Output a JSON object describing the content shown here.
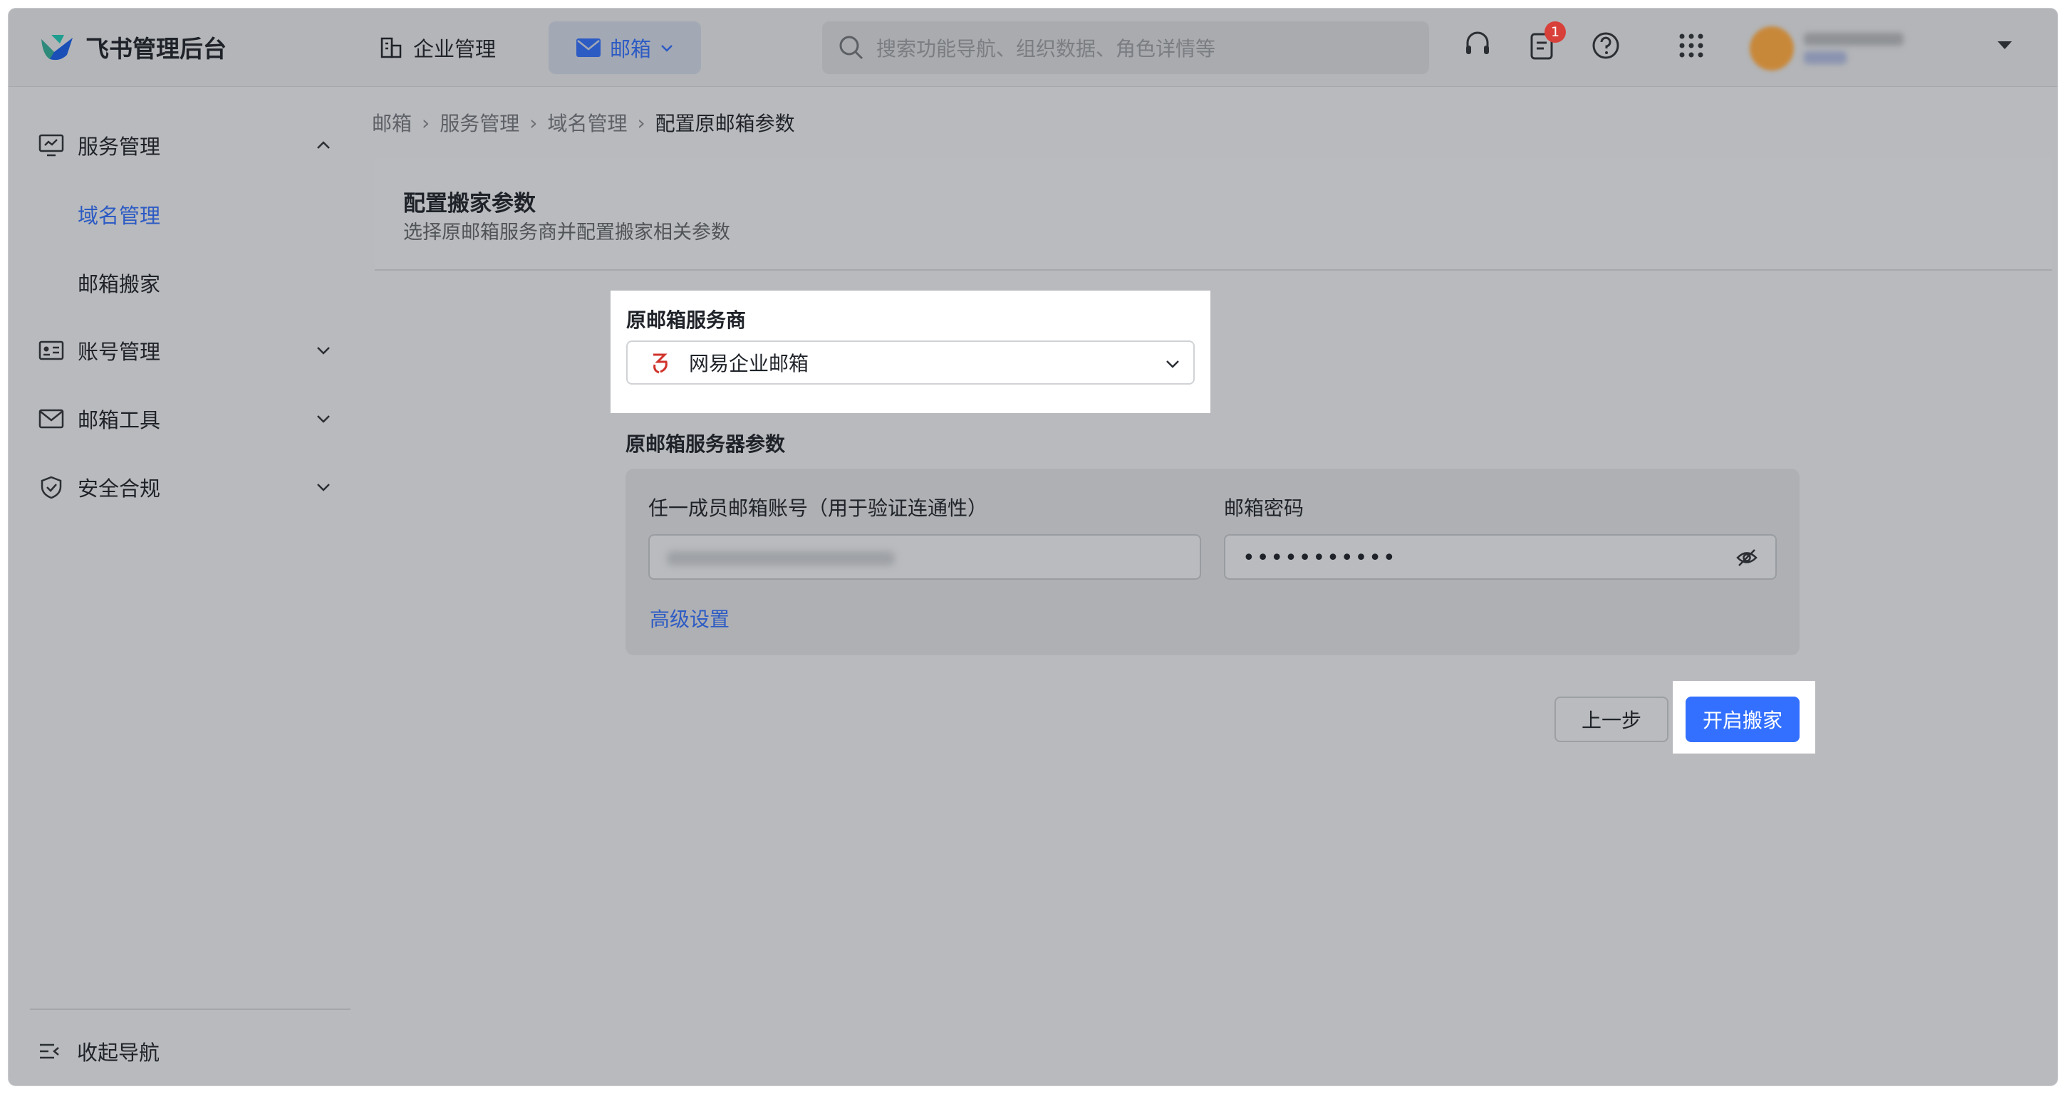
{
  "app": {
    "name": "飞书管理后台"
  },
  "topnav": {
    "enterprise_label": "企业管理",
    "mail_label": "邮箱",
    "search_placeholder": "搜索功能导航、组织数据、角色详情等",
    "notification_count": "1"
  },
  "sidebar": {
    "items": [
      {
        "label": "服务管理",
        "icon": "monitor-icon",
        "expanded": true
      },
      {
        "label": "账号管理",
        "icon": "id-card-icon",
        "expanded": false
      },
      {
        "label": "邮箱工具",
        "icon": "mail-icon",
        "expanded": false
      },
      {
        "label": "安全合规",
        "icon": "shield-check-icon",
        "expanded": false
      }
    ],
    "subitems": [
      {
        "label": "域名管理",
        "active": true
      },
      {
        "label": "邮箱搬家",
        "active": false
      }
    ],
    "collapse_label": "收起导航"
  },
  "breadcrumb": [
    "邮箱",
    "服务管理",
    "域名管理",
    "配置原邮箱参数"
  ],
  "page": {
    "title": "配置搬家参数",
    "subtitle": "选择原邮箱服务商并配置搬家相关参数"
  },
  "form": {
    "provider_label": "原邮箱服务商",
    "provider_value": "网易企业邮箱",
    "server_section_label": "原邮箱服务器参数",
    "account_label": "任一成员邮箱账号（用于验证连通性）",
    "password_label": "邮箱密码",
    "password_value": "•••••••••••",
    "advanced_link": "高级设置"
  },
  "actions": {
    "prev_label": "上一步",
    "start_label": "开启搬家"
  },
  "colors": {
    "accent": "#3370ff",
    "link": "#2d5bc4",
    "badge": "#d8403a"
  }
}
